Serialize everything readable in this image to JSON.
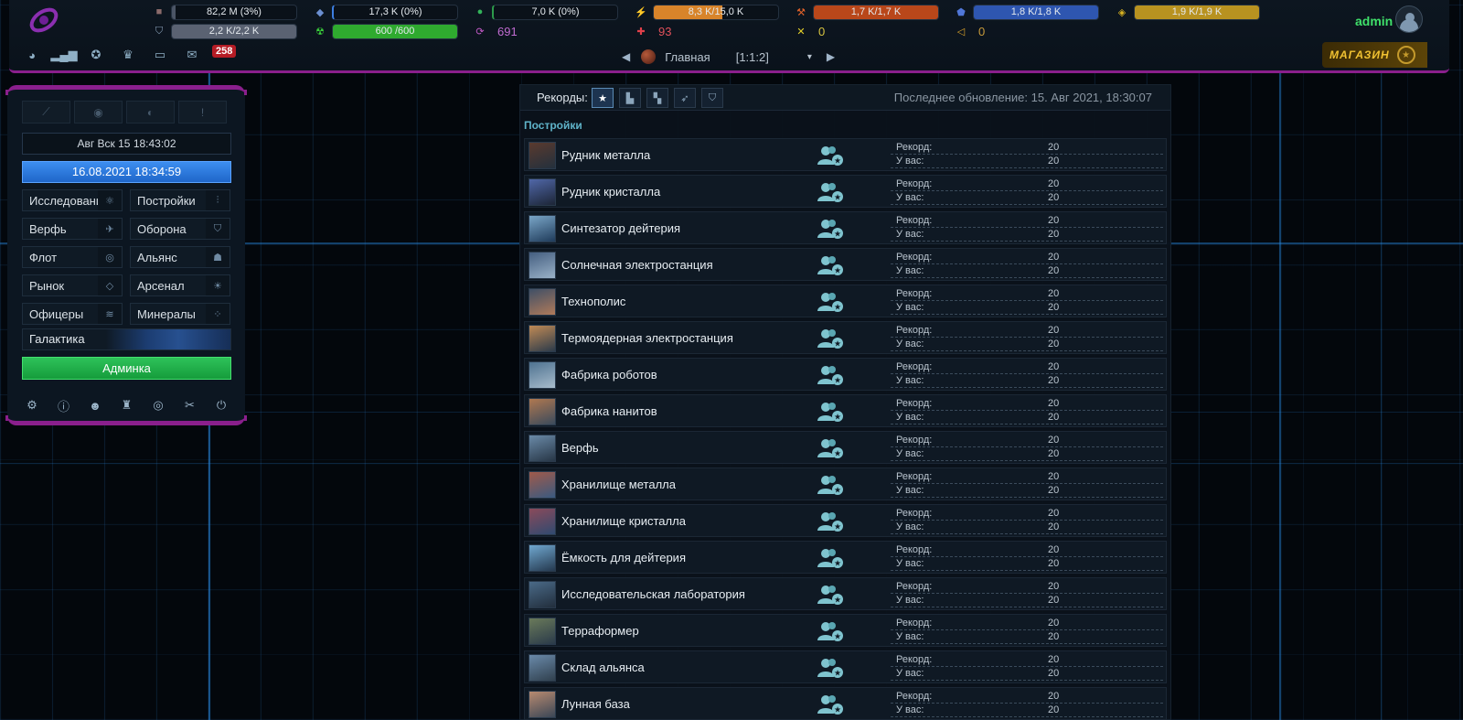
{
  "resources": [
    {
      "name": "metal",
      "icon": "metal-icon",
      "value": "82,2 M (3%)",
      "fill": 0.03,
      "color": "#4b5566"
    },
    {
      "name": "crystal",
      "icon": "crystal-icon",
      "value": "17,3 K (0%)",
      "fill": 0.0,
      "color": "#3d5f8f"
    },
    {
      "name": "deuterium",
      "icon": "deuterium-icon",
      "value": "7,0 K (0%)",
      "fill": 0.0,
      "color": "#2c9a4a"
    },
    {
      "name": "energy",
      "icon": "energy-icon",
      "value_a": "8,3 K/",
      "value_b": "15,0 K",
      "fill": 0.55,
      "color": "#d8842a"
    },
    {
      "name": "res5",
      "icon": "hammer-icon",
      "value_a": "1,7 K/",
      "value_b": "1,7 K",
      "fill": 1.0,
      "color": "#b9471a"
    },
    {
      "name": "res6",
      "icon": "shield-badge-icon",
      "value_a": "1,8 K/",
      "value_b": "1,8 K",
      "fill": 1.0,
      "color": "#2e56b0"
    },
    {
      "name": "res7",
      "icon": "target-icon",
      "value_a": "1,9 K/",
      "value_b": "1,9 K",
      "fill": 1.0,
      "color": "#b89220"
    },
    {
      "name": "defense",
      "icon": "shield-icon",
      "value_a": "2,2 K/",
      "value_b": "2,2 K",
      "fill": 1.0,
      "color": "#5a6272"
    },
    {
      "name": "radiation",
      "icon": "radiation-icon",
      "value_a": "600 /",
      "value_b": "600",
      "fill": 1.0,
      "color": "#2faa2f"
    }
  ],
  "counters": {
    "sync": "691",
    "pin": "93",
    "crossed": "0",
    "ship": "0"
  },
  "header": {
    "messages_badge": "258",
    "planet_name": "Главная",
    "coords": "[1:1:2]",
    "username": "admin",
    "shop": "МАГАЗИН"
  },
  "sidebar": {
    "server_time": "Авг Вск 15 18:43:02",
    "local_time": "16.08.2021 18:34:59",
    "menu": [
      {
        "label": "Исследования",
        "icon": "atom-icon",
        "key": "research"
      },
      {
        "label": "Постройки",
        "icon": "sliders-icon",
        "key": "buildings"
      },
      {
        "label": "Верфь",
        "icon": "ship-icon",
        "key": "shipyard"
      },
      {
        "label": "Оборона",
        "icon": "shield-icon",
        "key": "defense"
      },
      {
        "label": "Флот",
        "icon": "crosshair-icon",
        "key": "fleet"
      },
      {
        "label": "Альянс",
        "icon": "group-icon",
        "key": "alliance"
      },
      {
        "label": "Рынок",
        "icon": "tag-icon",
        "key": "market"
      },
      {
        "label": "Арсенал",
        "icon": "sun-icon",
        "key": "arsenal"
      },
      {
        "label": "Офицеры",
        "icon": "stack-icon",
        "key": "officers"
      },
      {
        "label": "Минералы",
        "icon": "nodes-icon",
        "key": "minerals"
      }
    ],
    "galaxy": "Галактика",
    "admin": "Админка"
  },
  "records": {
    "label": "Рекорды:",
    "last_update": "Последнее обновление: 15. Авг 2021, 18:30:07",
    "section": "Постройки",
    "record_label": "Рекорд:",
    "yours_label": "У вас:",
    "items": [
      {
        "name": "Рудник металла",
        "record": "20",
        "yours": "20"
      },
      {
        "name": "Рудник кристалла",
        "record": "20",
        "yours": "20"
      },
      {
        "name": "Синтезатор дейтерия",
        "record": "20",
        "yours": "20"
      },
      {
        "name": "Солнечная электростанция",
        "record": "20",
        "yours": "20"
      },
      {
        "name": "Технополис",
        "record": "20",
        "yours": "20"
      },
      {
        "name": "Термоядерная электростанция",
        "record": "20",
        "yours": "20"
      },
      {
        "name": "Фабрика роботов",
        "record": "20",
        "yours": "20"
      },
      {
        "name": "Фабрика нанитов",
        "record": "20",
        "yours": "20"
      },
      {
        "name": "Верфь",
        "record": "20",
        "yours": "20"
      },
      {
        "name": "Хранилище металла",
        "record": "20",
        "yours": "20"
      },
      {
        "name": "Хранилище кристалла",
        "record": "20",
        "yours": "20"
      },
      {
        "name": "Ёмкость для дейтерия",
        "record": "20",
        "yours": "20"
      },
      {
        "name": "Исследовательская лаборатория",
        "record": "20",
        "yours": "20"
      },
      {
        "name": "Терраформер",
        "record": "20",
        "yours": "20"
      },
      {
        "name": "Склад альянса",
        "record": "20",
        "yours": "20"
      },
      {
        "name": "Лунная база",
        "record": "20",
        "yours": "20"
      }
    ]
  }
}
